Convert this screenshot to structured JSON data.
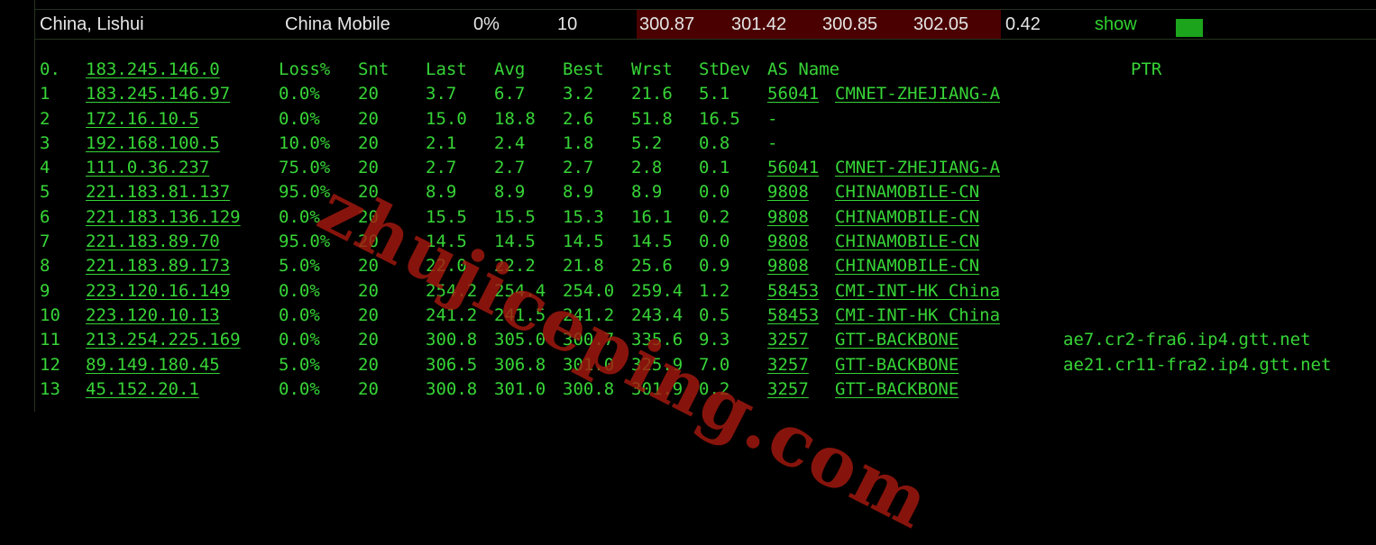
{
  "summary": {
    "location": "China, Lishui",
    "isp": "China Mobile",
    "loss": "0%",
    "sent": "10",
    "last": "300.87",
    "avg": "301.42",
    "best": "300.85",
    "worst": "302.05",
    "stdev": "0.42",
    "show_label": "show",
    "colors": {
      "highlight": "#4a0000",
      "accent": "#1ca51c",
      "text_green": "#37d437"
    }
  },
  "headers": {
    "idx": "0.",
    "host": "183.245.146.0",
    "loss": "Loss%",
    "snt": "Snt",
    "last": "Last",
    "avg": "Avg",
    "best": "Best",
    "wrst": "Wrst",
    "stdev": "StDev",
    "as_name": "AS Name",
    "ptr": "PTR"
  },
  "hops": [
    {
      "idx": "1",
      "host": "183.245.146.97",
      "loss": "0.0%",
      "snt": "20",
      "last": "3.7",
      "avg": "6.7",
      "best": "3.2",
      "wrst": "21.6",
      "stdev": "5.1",
      "asn": "56041",
      "as_name": "CMNET-ZHEJIANG-A",
      "ptr": ""
    },
    {
      "idx": "2",
      "host": "172.16.10.5",
      "loss": "0.0%",
      "snt": "20",
      "last": "15.0",
      "avg": "18.8",
      "best": "2.6",
      "wrst": "51.8",
      "stdev": "16.5",
      "asn": "-",
      "as_name": "",
      "ptr": ""
    },
    {
      "idx": "3",
      "host": "192.168.100.5",
      "loss": "10.0%",
      "snt": "20",
      "last": "2.1",
      "avg": "2.4",
      "best": "1.8",
      "wrst": "5.2",
      "stdev": "0.8",
      "asn": "-",
      "as_name": "",
      "ptr": ""
    },
    {
      "idx": "4",
      "host": "111.0.36.237",
      "loss": "75.0%",
      "snt": "20",
      "last": "2.7",
      "avg": "2.7",
      "best": "2.7",
      "wrst": "2.8",
      "stdev": "0.1",
      "asn": "56041",
      "as_name": "CMNET-ZHEJIANG-A",
      "ptr": ""
    },
    {
      "idx": "5",
      "host": "221.183.81.137",
      "loss": "95.0%",
      "snt": "20",
      "last": "8.9",
      "avg": "8.9",
      "best": "8.9",
      "wrst": "8.9",
      "stdev": "0.0",
      "asn": "9808",
      "as_name": "CHINAMOBILE-CN",
      "ptr": ""
    },
    {
      "idx": "6",
      "host": "221.183.136.129",
      "loss": "0.0%",
      "snt": "20",
      "last": "15.5",
      "avg": "15.5",
      "best": "15.3",
      "wrst": "16.1",
      "stdev": "0.2",
      "asn": "9808",
      "as_name": "CHINAMOBILE-CN",
      "ptr": ""
    },
    {
      "idx": "7",
      "host": "221.183.89.70",
      "loss": "95.0%",
      "snt": "20",
      "last": "14.5",
      "avg": "14.5",
      "best": "14.5",
      "wrst": "14.5",
      "stdev": "0.0",
      "asn": "9808",
      "as_name": "CHINAMOBILE-CN",
      "ptr": ""
    },
    {
      "idx": "8",
      "host": "221.183.89.173",
      "loss": "5.0%",
      "snt": "20",
      "last": "22.0",
      "avg": "22.2",
      "best": "21.8",
      "wrst": "25.6",
      "stdev": "0.9",
      "asn": "9808",
      "as_name": "CHINAMOBILE-CN",
      "ptr": ""
    },
    {
      "idx": "9",
      "host": "223.120.16.149",
      "loss": "0.0%",
      "snt": "20",
      "last": "254.2",
      "avg": "254.4",
      "best": "254.0",
      "wrst": "259.4",
      "stdev": "1.2",
      "asn": "58453",
      "as_name": "CMI-INT-HK China",
      "ptr": ""
    },
    {
      "idx": "10",
      "host": "223.120.10.13",
      "loss": "0.0%",
      "snt": "20",
      "last": "241.2",
      "avg": "241.5",
      "best": "241.2",
      "wrst": "243.4",
      "stdev": "0.5",
      "asn": "58453",
      "as_name": "CMI-INT-HK China",
      "ptr": ""
    },
    {
      "idx": "11",
      "host": "213.254.225.169",
      "loss": "0.0%",
      "snt": "20",
      "last": "300.8",
      "avg": "305.0",
      "best": "300.7",
      "wrst": "335.6",
      "stdev": "9.3",
      "asn": "3257",
      "as_name": "GTT-BACKBONE",
      "ptr": "ae7.cr2-fra6.ip4.gtt.net"
    },
    {
      "idx": "12",
      "host": "89.149.180.45",
      "loss": "5.0%",
      "snt": "20",
      "last": "306.5",
      "avg": "306.8",
      "best": "301.0",
      "wrst": "325.9",
      "stdev": "7.0",
      "asn": "3257",
      "as_name": "GTT-BACKBONE",
      "ptr": "ae21.cr11-fra2.ip4.gtt.net"
    },
    {
      "idx": "13",
      "host": "45.152.20.1",
      "loss": "0.0%",
      "snt": "20",
      "last": "300.8",
      "avg": "301.0",
      "best": "300.8",
      "wrst": "301.9",
      "stdev": "0.2",
      "asn": "3257",
      "as_name": "GTT-BACKBONE",
      "ptr": ""
    }
  ],
  "watermark": "zhujiceping.com"
}
